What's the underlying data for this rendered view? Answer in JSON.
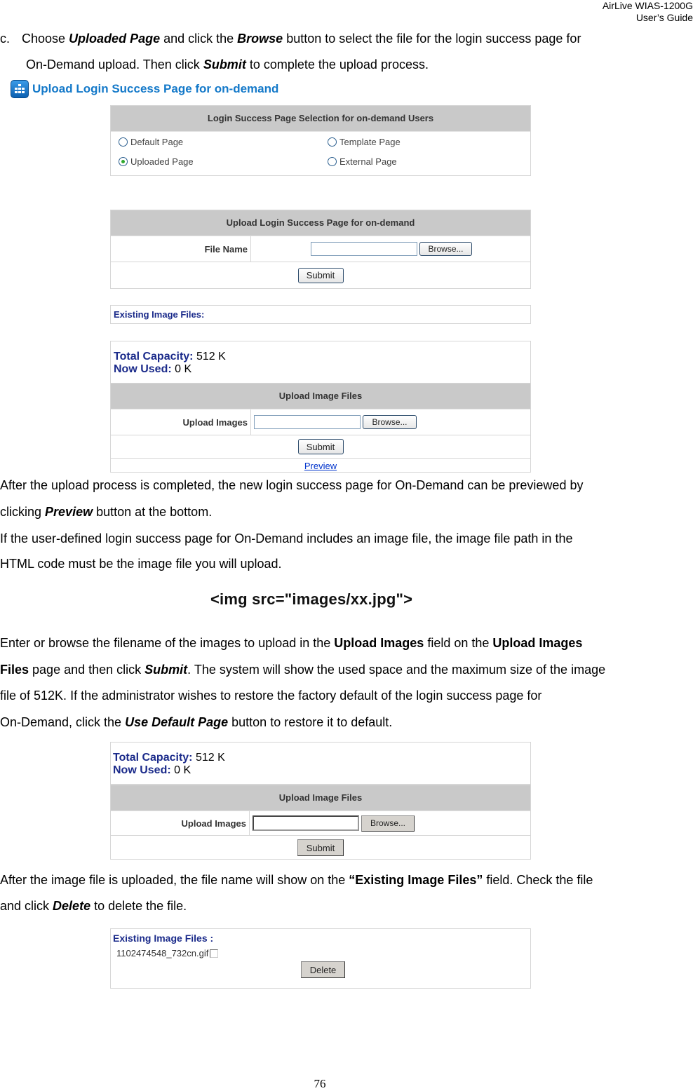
{
  "header": {
    "line1": "AirLive  WIAS-1200G",
    "line2": "User’s  Guide"
  },
  "step_c": {
    "marker": "c.",
    "l1_a": "Choose ",
    "l1_b": "Uploaded Page",
    "l1_c": " and click the ",
    "l1_d": "Browse",
    "l1_e": " button to select the file for the login success page for",
    "l2_a": "On-Demand upload. Then click ",
    "l2_b": "Submit",
    "l2_c": " to complete the upload process."
  },
  "shot1": {
    "title": "Upload Login Success Page for on-demand",
    "selection_header": "Login Success Page Selection for on-demand Users",
    "options": [
      {
        "label": "Default Page",
        "checked": false
      },
      {
        "label": "Template Page",
        "checked": false
      },
      {
        "label": "Uploaded Page",
        "checked": true
      },
      {
        "label": "External Page",
        "checked": false
      }
    ],
    "upload_header": "Upload Login Success Page for on-demand",
    "file_name_label": "File Name",
    "file_name_value": "",
    "browse_label": "Browse...",
    "submit_label": "Submit",
    "existing_label": "Existing Image Files:",
    "total_capacity_label": "Total Capacity:",
    "total_capacity_value": " 512 K",
    "now_used_label": "Now Used:",
    "now_used_value": " 0 K",
    "image_header": "Upload Image Files",
    "upload_images_label": "Upload Images",
    "upload_images_value": "",
    "browse2_label": "Browse...",
    "submit2_label": "Submit",
    "preview_label": "Preview"
  },
  "para1": {
    "l1": "After the upload process is completed, the new login success page for On-Demand can be previewed by",
    "l2_a": "clicking ",
    "l2_b": "Preview",
    "l2_c": " button at the bottom."
  },
  "para2": {
    "l1": "If the user-defined login success page for On-Demand includes an image file, the image file path in the",
    "l2": "HTML code must be the image file you will upload."
  },
  "code_sample": "<img src=\"images/xx.jpg\">",
  "para3": {
    "l1_a": "Enter or browse the filename of the images to upload in the ",
    "l1_b": "Upload Images",
    "l1_c": " field on the ",
    "l1_d": "Upload Images",
    "l2_a": "Files",
    "l2_b": " page and then click ",
    "l2_c": "Submit",
    "l2_d": ". The system will show the used space and the maximum size of the image",
    "l3": "file of 512K. If the administrator wishes to restore the factory default of the login success page for",
    "l4_a": "On-Demand, click the ",
    "l4_b": "Use Default Page",
    "l4_c": " button to restore it to default."
  },
  "shot2": {
    "total_capacity_label": "Total Capacity:",
    "total_capacity_value": " 512 K",
    "now_used_label": "Now Used:",
    "now_used_value": " 0 K",
    "image_header": "Upload Image Files",
    "upload_images_label": "Upload Images",
    "upload_images_value": "",
    "browse_label": "Browse...",
    "submit_label": "Submit"
  },
  "para4": {
    "l1_a": "After the image file is uploaded, the file name will show on the ",
    "l1_b": "“Existing Image Files”",
    "l1_c": " field. Check the file",
    "l2_a": "and click ",
    "l2_b": "Delete",
    "l2_c": " to delete the file."
  },
  "shot3": {
    "existing_label": "Existing Image Files :",
    "file_name": "1102474548_732cn.gif",
    "file_checked": false,
    "delete_label": "Delete"
  },
  "page_number": "76"
}
